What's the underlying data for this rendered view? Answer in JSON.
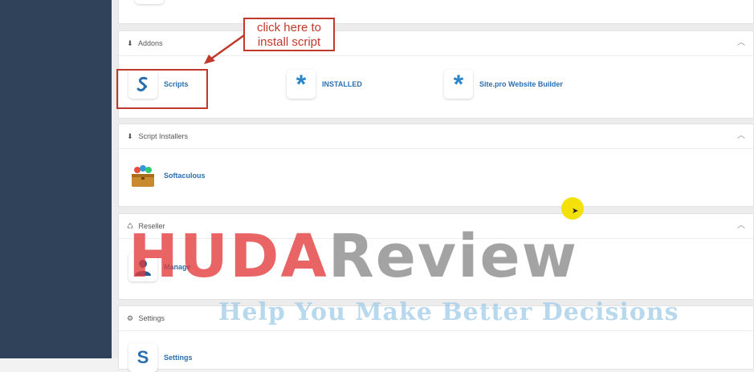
{
  "annotation": {
    "line1": "click here to",
    "line2": "install script"
  },
  "sections": {
    "addons": {
      "title": "Addons",
      "items": [
        {
          "label": "Scripts",
          "icon": "scripts-logo-icon"
        },
        {
          "label": "INSTALLED",
          "icon": "asterisk-icon"
        },
        {
          "label": "Site.pro Website Builder",
          "icon": "asterisk-icon"
        }
      ]
    },
    "script_installers": {
      "title": "Script Installers",
      "items": [
        {
          "label": "Softaculous",
          "icon": "softaculous-icon"
        }
      ]
    },
    "reseller": {
      "title": "Reseller",
      "items": [
        {
          "label": "Manage",
          "icon": "user-icon"
        }
      ]
    },
    "settings": {
      "title": "Settings",
      "items": [
        {
          "label": "Settings",
          "icon": "settings-logo-icon"
        }
      ]
    }
  },
  "watermark": {
    "brand_a": "HUDA",
    "brand_b": "Review",
    "tagline": "Help You Make Better Decisions"
  },
  "colors": {
    "sidebar": "#2f4259",
    "link": "#2a6fb0",
    "annotation": "#c0392b",
    "cursor_highlight": "#f4e10a"
  }
}
